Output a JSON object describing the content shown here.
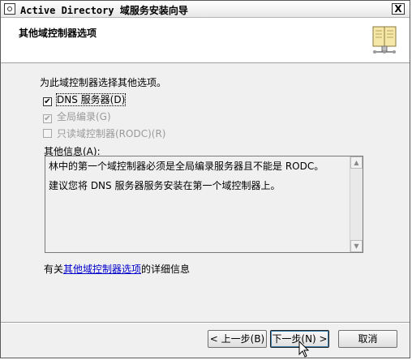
{
  "window": {
    "title": "Active Directory 域服务安装向导",
    "close_label": "X",
    "app_icon": "ad-icon"
  },
  "header": {
    "title": "其他域控制器选项",
    "icon": "book-icon"
  },
  "body": {
    "intro": "为此域控制器选择其他选项。",
    "options": [
      {
        "label": "DNS 服务器(D)",
        "checked": true,
        "enabled": true
      },
      {
        "label": "全局编录(G)",
        "checked": true,
        "enabled": false
      },
      {
        "label": "只读域控制器(RODC)(R)",
        "checked": false,
        "enabled": false
      }
    ],
    "info_label": "其他信息(A):",
    "info_lines": [
      "林中的第一个域控制器必须是全局编录服务器且不能是 RODC。",
      "建议您将 DNS 服务器服务安装在第一个域控制器上。"
    ],
    "more_info_prefix": "有关",
    "more_info_link": "其他域控制器选项",
    "more_info_suffix": "的详细信息"
  },
  "buttons": {
    "back": "< 上一步(B)",
    "next": "下一步(N) >",
    "cancel": "取消"
  },
  "scroll": {
    "up_icon": "▲",
    "down_icon": "▼"
  }
}
